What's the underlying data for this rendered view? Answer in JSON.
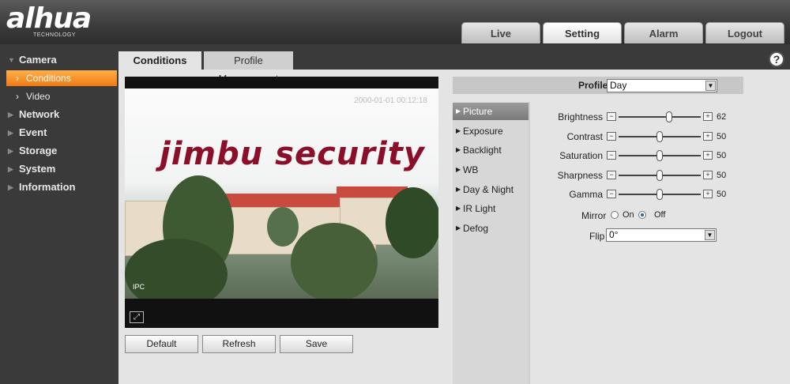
{
  "header": {
    "logo_text": "alhua",
    "logo_sub": "TECHNOLOGY",
    "tabs": [
      {
        "label": "Live"
      },
      {
        "label": "Setting"
      },
      {
        "label": "Alarm"
      },
      {
        "label": "Logout"
      }
    ],
    "active_tab": "Setting"
  },
  "sidebar": {
    "camera": "Camera",
    "conditions": "Conditions",
    "video": "Video",
    "network": "Network",
    "event": "Event",
    "storage": "Storage",
    "system": "System",
    "information": "Information"
  },
  "content_tabs": {
    "conditions": "Conditions",
    "profile_management": "Profile Management"
  },
  "video": {
    "timestamp": "2000-01-01 00:12:18",
    "watermark": "jimbu security",
    "channel_label": "IPC"
  },
  "buttons": {
    "default": "Default",
    "refresh": "Refresh",
    "save": "Save"
  },
  "profile": {
    "label": "Profile",
    "value": "Day"
  },
  "nav": {
    "picture": "Picture",
    "exposure": "Exposure",
    "backlight": "Backlight",
    "wb": "WB",
    "day_night": "Day & Night",
    "ir_light": "IR Light",
    "defog": "Defog"
  },
  "settings": {
    "brightness": {
      "label": "Brightness",
      "value": "62",
      "fraction": 0.62
    },
    "contrast": {
      "label": "Contrast",
      "value": "50",
      "fraction": 0.5
    },
    "saturation": {
      "label": "Saturation",
      "value": "50",
      "fraction": 0.5
    },
    "sharpness": {
      "label": "Sharpness",
      "value": "50",
      "fraction": 0.5
    },
    "gamma": {
      "label": "Gamma",
      "value": "50",
      "fraction": 0.5
    },
    "mirror": {
      "label": "Mirror",
      "on": "On",
      "off": "Off",
      "selected": "Off"
    },
    "flip": {
      "label": "Flip",
      "value": "0°"
    }
  },
  "colors": {
    "accent": "#f07a12",
    "watermark": "#8c0f2a"
  }
}
